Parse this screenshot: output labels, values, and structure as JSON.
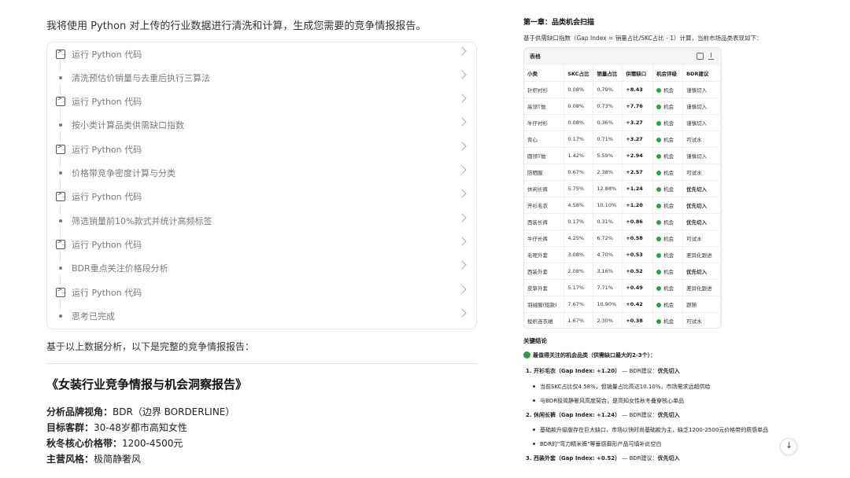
{
  "intro": "我将使用 Python 对上传的行业数据进行清洗和计算，生成您需要的竞争情报报告。",
  "steps": [
    {
      "type": "code",
      "label": "运行 Python 代码"
    },
    {
      "type": "text",
      "label": "清洗预估价销量与去重后执行三算法"
    },
    {
      "type": "code",
      "label": "运行 Python 代码"
    },
    {
      "type": "text",
      "label": "按小类计算品类供需缺口指数"
    },
    {
      "type": "code",
      "label": "运行 Python 代码"
    },
    {
      "type": "text",
      "label": "价格带竞争密度计算与分类"
    },
    {
      "type": "code",
      "label": "运行 Python 代码"
    },
    {
      "type": "text",
      "label": "筛选销量前10%款式并统计高频标签"
    },
    {
      "type": "code",
      "label": "运行 Python 代码"
    },
    {
      "type": "text",
      "label": "BDR重点关注价格段分析"
    },
    {
      "type": "code",
      "label": "运行 Python 代码"
    },
    {
      "type": "text",
      "label": "思考已完成"
    }
  ],
  "summary": "基于以上数据分析，以下是完整的竞争情报报告：",
  "report_title": "《女装行业竞争情报与机会洞察报告》",
  "meta": [
    {
      "key": "分析品牌视角：",
      "value": "BDR（边界 BORDERLINE）"
    },
    {
      "key": "目标客群：",
      "value": "30-48岁都市高知女性"
    },
    {
      "key": "秋冬核心价格带：",
      "value": "1200-4500元"
    },
    {
      "key": "主营风格：",
      "value": "极简静奢风"
    }
  ],
  "chapter": {
    "title": "第一章：品类机会扫描",
    "desc": "基于供需缺口指数（Gap Index = 销量占比/SKC占比 - 1）计算，当前市场品类表现如下："
  },
  "table": {
    "label": "表格",
    "columns": [
      "小类",
      "SKC占比",
      "销量占比",
      "供需缺口",
      "机会评级",
      "BDR建议"
    ],
    "rows": [
      [
        "针织衬衫",
        "0.08%",
        "0.79%",
        "+8.43",
        "机会",
        "谨慎切入",
        false
      ],
      [
        "高领T恤",
        "0.08%",
        "0.73%",
        "+7.76",
        "机会",
        "谨慎切入",
        false
      ],
      [
        "牛仔衬衫",
        "0.08%",
        "0.36%",
        "+3.27",
        "机会",
        "谨慎切入",
        false
      ],
      [
        "背心",
        "0.17%",
        "0.71%",
        "+3.27",
        "机会",
        "可试水",
        false
      ],
      [
        "圆领T恤",
        "1.42%",
        "5.59%",
        "+2.94",
        "机会",
        "谨慎切入",
        false
      ],
      [
        "防晒服",
        "0.67%",
        "2.38%",
        "+2.57",
        "机会",
        "可试水",
        false
      ],
      [
        "休闲长裤",
        "5.75%",
        "12.88%",
        "+1.24",
        "机会",
        "优先切入",
        true
      ],
      [
        "开衫毛衣",
        "4.58%",
        "10.10%",
        "+1.20",
        "机会",
        "优先切入",
        true
      ],
      [
        "西装长裤",
        "0.17%",
        "0.31%",
        "+0.86",
        "机会",
        "优先切入",
        true
      ],
      [
        "牛仔长裤",
        "4.25%",
        "6.72%",
        "+0.58",
        "机会",
        "可试水",
        false
      ],
      [
        "毛呢外套",
        "3.08%",
        "4.70%",
        "+0.53",
        "机会",
        "差异化跟进",
        false
      ],
      [
        "西装外套",
        "2.08%",
        "3.16%",
        "+0.52",
        "机会",
        "优先切入",
        true
      ],
      [
        "皮草外套",
        "5.17%",
        "7.71%",
        "+0.49",
        "机会",
        "差异化跟进",
        false
      ],
      [
        "羽绒服(短款)",
        "7.67%",
        "10.90%",
        "+0.42",
        "机会",
        "跟随",
        false
      ],
      [
        "梭织连衣裙",
        "1.67%",
        "2.30%",
        "+0.38",
        "机会",
        "可试水",
        false
      ]
    ]
  },
  "key_conclusions": {
    "title": "关键结论",
    "lead": "最值得关注的机会品类（供需缺口最大的2-3个）：",
    "items": [
      {
        "head": "1. 开衫毛衣（Gap Index: +1.20）",
        "rest": " — BDR建议：",
        "advice": "优先切入",
        "bullets": [
          "当前SKC占比仅4.58%，但销量占比高达10.10%，市场需求远超供给",
          "与BDR极简静奢风高度契合，是高知女性秋冬叠穿核心单品"
        ]
      },
      {
        "head": "2. 休闲长裤（Gap Index: +1.24）",
        "rest": " — BDR建议：",
        "advice": "优先切入",
        "bullets": [
          "基础款升级版存在巨大缺口，市场以快时尚基础款为主，缺乏1200-2500元价格带的质感单品",
          "BDR的\"弯刀精米裤\"等垂感廓形产品可填补此空白"
        ]
      },
      {
        "head": "3. 西装外套（Gap Index: +0.52）",
        "rest": " — BDR建议：",
        "advice": "优先切入",
        "bullets": []
      }
    ]
  },
  "scroll_glyph": "↓"
}
